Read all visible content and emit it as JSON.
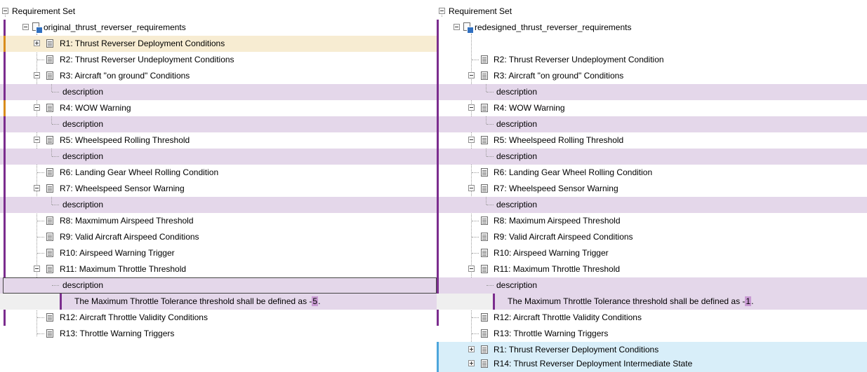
{
  "colors": {
    "changed_marker": "#7b2d8e",
    "modified_marker": "#d98c1c",
    "added_marker": "#4ea6dc",
    "changed_highlight": "#e4d7ea",
    "modified_highlight": "#f7ecd2",
    "added_highlight": "#d8eef9"
  },
  "left": {
    "root_label": "Requirement Set",
    "set_label": "original_thrust_reverser_requirements",
    "items": [
      "R1: Thrust Reverser Deployment Conditions",
      "R2: Thrust Reverser Undeployment Conditions",
      "R3: Aircraft \"on ground\" Conditions",
      "description",
      "R4: WOW Warning",
      "description",
      "R5: Wheelspeed Rolling Threshold",
      "description",
      "R6: Landing Gear Wheel Rolling Condition",
      "R7: Wheelspeed Sensor Warning",
      "description",
      "R8: Maxmimum Airspeed Threshold",
      "R9: Valid Aircraft Airspeed Conditions",
      "R10: Airspeed Warning Trigger",
      "R11: Maximum Throttle Threshold",
      "description",
      "R12: Aircraft Throttle Validity Conditions",
      "R13: Throttle Warning Triggers"
    ],
    "detail_prefix": "The Maximum Throttle Tolerance threshold shall be defined as -",
    "detail_changed": "5",
    "detail_suffix": "."
  },
  "right": {
    "root_label": "Requirement Set",
    "set_label": "redesigned_thrust_reverser_requirements",
    "items": [
      "R2: Thrust Reverser Undeployment Condition",
      "R3: Aircraft \"on ground\" Conditions",
      "description",
      "R4: WOW Warning",
      "description",
      "R5: Wheelspeed Rolling Threshold",
      "description",
      "R6: Landing Gear Wheel Rolling Condition",
      "R7: Wheelspeed Sensor Warning",
      "description",
      "R8: Maximum Airspeed Threshold",
      "R9: Valid Aircraft Airspeed Conditions",
      "R10: Airspeed Warning Trigger",
      "R11: Maximum Throttle Threshold",
      "description",
      "R12: Aircraft Throttle Validity Conditions",
      "R13: Throttle Warning Triggers",
      "R1: Thrust Reverser Deployment Conditions",
      "R14: Thrust Reverser Deployment Intermediate State"
    ],
    "detail_prefix": "The Maximum Throttle Tolerance threshold shall be defined as -",
    "detail_changed": "1",
    "detail_suffix": "."
  }
}
